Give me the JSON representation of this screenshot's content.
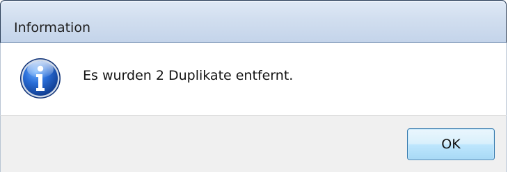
{
  "dialog": {
    "title": "Information",
    "message": "Es wurden 2 Duplikate entfernt.",
    "icon": "information-icon",
    "ok_label": "OK"
  },
  "colors": {
    "titlebar": "#d1deef",
    "footer": "#f0f0f0",
    "button_border": "#3c7fb1",
    "icon_blue": "#1f56b5"
  }
}
